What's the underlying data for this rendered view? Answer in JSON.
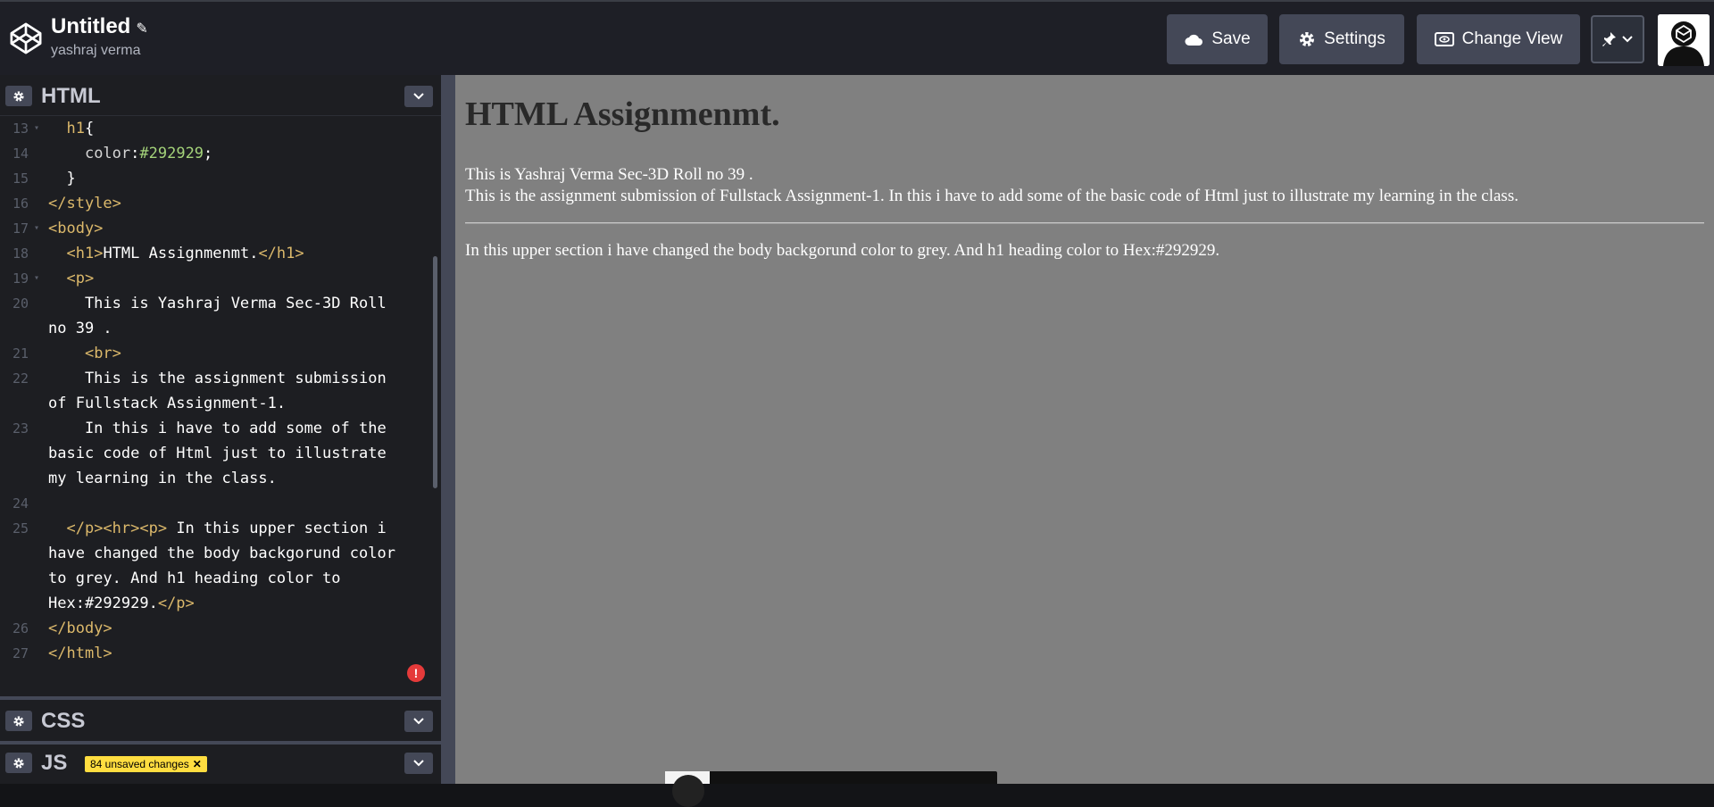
{
  "header": {
    "title": "Untitled",
    "author": "yashraj verma",
    "buttons": {
      "save": "Save",
      "settings": "Settings",
      "change_view": "Change View"
    }
  },
  "panels": {
    "html": "HTML",
    "css": "CSS",
    "js": "JS",
    "unsaved_badge": "84 unsaved changes"
  },
  "editor": {
    "lines": [
      {
        "n": "13"
      },
      {
        "n": "14"
      },
      {
        "n": "15"
      },
      {
        "n": "16"
      },
      {
        "n": "17"
      },
      {
        "n": "18"
      },
      {
        "n": "19"
      },
      {
        "n": "20"
      },
      {
        "n": "21"
      },
      {
        "n": "22"
      },
      {
        "n": "23"
      },
      {
        "n": "24"
      },
      {
        "n": "25"
      },
      {
        "n": "26"
      },
      {
        "n": "27"
      }
    ]
  },
  "preview": {
    "heading": "HTML Assignmenmt.",
    "line1": "This is Yashraj Verma Sec-3D Roll no 39 .",
    "line2": "This is the assignment submission of Fullstack Assignment-1. In this i have to add some of the basic code of Html just to illustrate my learning in the class.",
    "para2": "In this upper section i have changed the body backgorund color to grey. And h1 heading color to Hex:#292929."
  },
  "colors": {
    "accent_badge": "#ffdd40",
    "heading": "#292929",
    "preview_bg": "#808080",
    "error": "#e53a3a"
  },
  "icons": [
    "codepen-logo-icon",
    "pencil-icon",
    "cloud-icon",
    "gear-icon",
    "eye-icon",
    "pin-icon",
    "chevron-down-icon",
    "avatar-icon",
    "error-icon",
    "close-icon"
  ]
}
